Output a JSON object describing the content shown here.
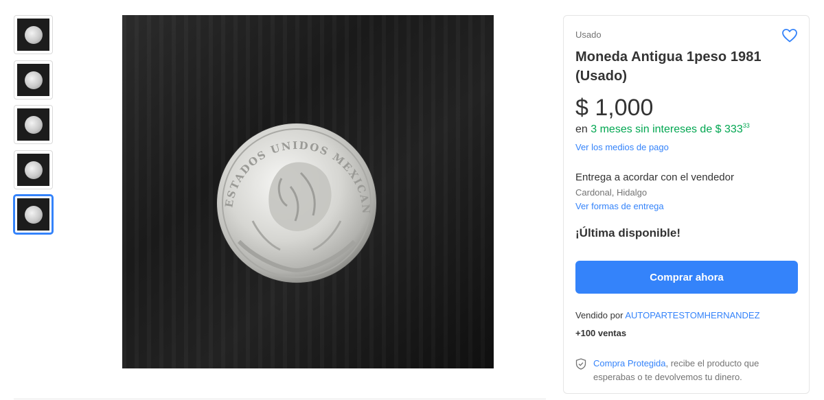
{
  "gallery": {
    "thumbnails": [
      {
        "label": "thumbnail 1"
      },
      {
        "label": "thumbnail 2"
      },
      {
        "label": "thumbnail 3"
      },
      {
        "label": "thumbnail 4"
      },
      {
        "label": "thumbnail 5",
        "active": true
      }
    ],
    "main_photo_alt": "coin"
  },
  "product": {
    "condition": "Usado",
    "title": "Moneda Antigua 1peso 1981 (Usado)",
    "price": "$ 1,000",
    "installments": {
      "prefix": "en",
      "green_text": "3 meses sin intereses de $ 333",
      "cents": "33"
    },
    "payment_link": "Ver los medios de pago",
    "delivery_text": "Entrega a acordar con el vendedor",
    "location": "Cardonal, Hidalgo",
    "delivery_link": "Ver formas de entrega",
    "stock_text": "¡Última disponible!",
    "buy_button": "Comprar ahora",
    "seller_prefix": "Vendido por",
    "seller_name": "AUTOPARTESTOMHERNANDEZ",
    "sales": "+100 ventas",
    "protection_link": "Compra Protegida",
    "protection_text": ", recibe el producto que esperabas o te devolvemos tu dinero."
  },
  "coin_text": {
    "legend": "ESTADOS UNIDOS MEXICANOS"
  },
  "colors": {
    "accent": "#3483fa",
    "green": "#00a650"
  },
  "icons": {
    "favorite": "heart-outline-icon",
    "protection": "shield-check-icon"
  }
}
